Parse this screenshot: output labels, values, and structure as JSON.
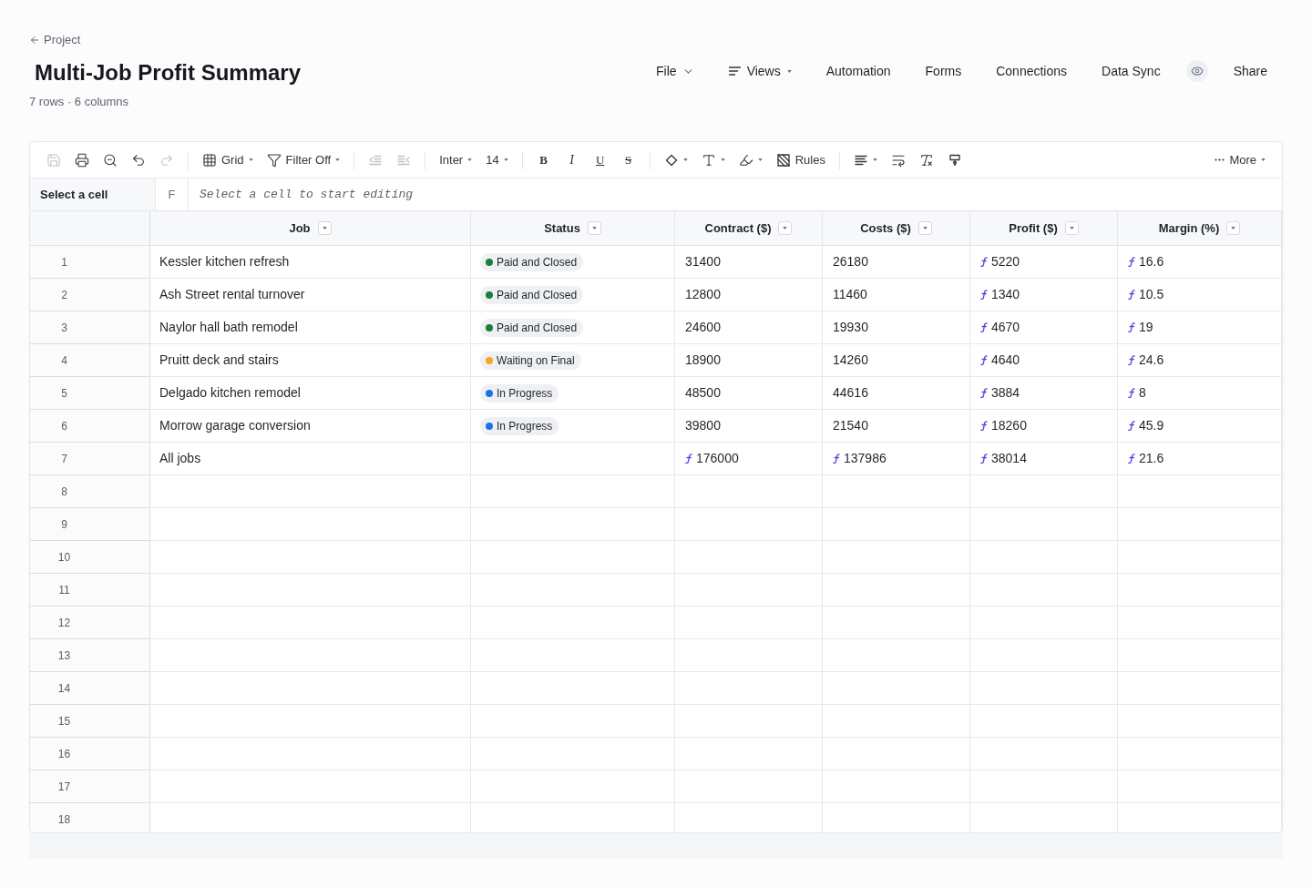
{
  "back_link": {
    "label": "Project"
  },
  "title": "Multi-Job Profit Summary",
  "subtitle": "7 rows · 6 columns",
  "nav": [
    {
      "kind": "menu",
      "label": "File"
    },
    {
      "kind": "views",
      "label": "Views"
    },
    {
      "kind": "link",
      "label": "Automation"
    },
    {
      "kind": "link",
      "label": "Forms"
    },
    {
      "kind": "link",
      "label": "Connections"
    },
    {
      "kind": "link",
      "label": "Data Sync"
    },
    {
      "kind": "preview"
    },
    {
      "kind": "link",
      "label": "Share"
    }
  ],
  "toolbar": {
    "groups": [
      [
        {
          "kind": "save",
          "disabled": true,
          "dropdown": false
        },
        {
          "kind": "print",
          "disabled": false,
          "dropdown": false
        },
        {
          "kind": "zoom",
          "disabled": false,
          "dropdown": false
        },
        {
          "kind": "undo",
          "disabled": false,
          "dropdown": false
        },
        {
          "kind": "redo",
          "disabled": true,
          "dropdown": false
        }
      ],
      [
        {
          "kind": "grid",
          "label": "Grid",
          "disabled": false,
          "dropdown": true
        },
        {
          "kind": "filter",
          "label": "Filter Off",
          "disabled": false,
          "dropdown": true
        }
      ],
      [
        {
          "kind": "outdent",
          "disabled": true,
          "dropdown": false
        },
        {
          "kind": "indent",
          "disabled": true,
          "dropdown": false
        }
      ],
      [
        {
          "kind": "font",
          "label": "Inter",
          "disabled": false,
          "dropdown": true
        },
        {
          "kind": "size",
          "label": "14",
          "disabled": false,
          "dropdown": true
        }
      ],
      [
        {
          "kind": "bold",
          "label": "B",
          "disabled": false,
          "dropdown": false
        },
        {
          "kind": "italic",
          "label": "I",
          "disabled": false,
          "dropdown": false
        },
        {
          "kind": "underline",
          "label": "U",
          "disabled": false,
          "dropdown": false
        },
        {
          "kind": "strike",
          "label": "S",
          "disabled": false,
          "dropdown": false
        }
      ],
      [
        {
          "kind": "fill",
          "disabled": false,
          "dropdown": true
        },
        {
          "kind": "text",
          "disabled": false,
          "dropdown": true
        },
        {
          "kind": "pen",
          "disabled": false,
          "dropdown": true
        },
        {
          "kind": "rules",
          "label": "Rules",
          "disabled": false,
          "dropdown": false
        }
      ],
      [
        {
          "kind": "align",
          "disabled": false,
          "dropdown": true
        },
        {
          "kind": "wrap",
          "disabled": false,
          "dropdown": false
        },
        {
          "kind": "clear",
          "disabled": false,
          "dropdown": false
        },
        {
          "kind": "paint",
          "disabled": false,
          "dropdown": false
        }
      ]
    ],
    "right": [
      {
        "kind": "more",
        "label": "More",
        "disabled": false,
        "dropdown": true
      }
    ]
  },
  "formula_bar": {
    "cell_reference": "Select a cell",
    "function_label": "F",
    "placeholder": "Select a cell to start editing"
  },
  "table": {
    "columns": [
      {
        "label": "Job"
      },
      {
        "label": "Status"
      },
      {
        "label": "Contract ($)"
      },
      {
        "label": "Costs ($)"
      },
      {
        "label": "Profit ($)"
      },
      {
        "label": "Margin (%)"
      }
    ],
    "rows": [
      {
        "number": "1",
        "job": "Kessler kitchen refresh",
        "status": {
          "label": "Paid and Closed",
          "color": "#1a7f37"
        },
        "contract": {
          "value": "31400",
          "formula": false
        },
        "costs": {
          "value": "26180",
          "formula": false
        },
        "profit": {
          "value": "5220",
          "formula": true
        },
        "margin": {
          "value": "16.6",
          "formula": true
        }
      },
      {
        "number": "2",
        "job": "Ash Street rental turnover",
        "status": {
          "label": "Paid and Closed",
          "color": "#1a7f37"
        },
        "contract": {
          "value": "12800",
          "formula": false
        },
        "costs": {
          "value": "11460",
          "formula": false
        },
        "profit": {
          "value": "1340",
          "formula": true
        },
        "margin": {
          "value": "10.5",
          "formula": true
        }
      },
      {
        "number": "3",
        "job": "Naylor hall bath remodel",
        "status": {
          "label": "Paid and Closed",
          "color": "#1a7f37"
        },
        "contract": {
          "value": "24600",
          "formula": false
        },
        "costs": {
          "value": "19930",
          "formula": false
        },
        "profit": {
          "value": "4670",
          "formula": true
        },
        "margin": {
          "value": "19",
          "formula": true
        }
      },
      {
        "number": "4",
        "job": "Pruitt deck and stairs",
        "status": {
          "label": "Waiting on Final",
          "color": "#f5a623"
        },
        "contract": {
          "value": "18900",
          "formula": false
        },
        "costs": {
          "value": "14260",
          "formula": false
        },
        "profit": {
          "value": "4640",
          "formula": true
        },
        "margin": {
          "value": "24.6",
          "formula": true
        }
      },
      {
        "number": "5",
        "job": "Delgado kitchen remodel",
        "status": {
          "label": "In Progress",
          "color": "#1a73e8"
        },
        "contract": {
          "value": "48500",
          "formula": false
        },
        "costs": {
          "value": "44616",
          "formula": false
        },
        "profit": {
          "value": "3884",
          "formula": true
        },
        "margin": {
          "value": "8",
          "formula": true
        }
      },
      {
        "number": "6",
        "job": "Morrow garage conversion",
        "status": {
          "label": "In Progress",
          "color": "#1a73e8"
        },
        "contract": {
          "value": "39800",
          "formula": false
        },
        "costs": {
          "value": "21540",
          "formula": false
        },
        "profit": {
          "value": "18260",
          "formula": true
        },
        "margin": {
          "value": "45.9",
          "formula": true
        }
      },
      {
        "number": "7",
        "job": "All jobs",
        "contract": {
          "value": "176000",
          "formula": true
        },
        "costs": {
          "value": "137986",
          "formula": true
        },
        "profit": {
          "value": "38014",
          "formula": true
        },
        "margin": {
          "value": "21.6",
          "formula": true
        }
      },
      {
        "number": "8"
      },
      {
        "number": "9"
      },
      {
        "number": "10"
      },
      {
        "number": "11"
      },
      {
        "number": "12"
      },
      {
        "number": "13"
      },
      {
        "number": "14"
      },
      {
        "number": "15"
      },
      {
        "number": "16"
      },
      {
        "number": "17"
      },
      {
        "number": "18"
      }
    ]
  }
}
